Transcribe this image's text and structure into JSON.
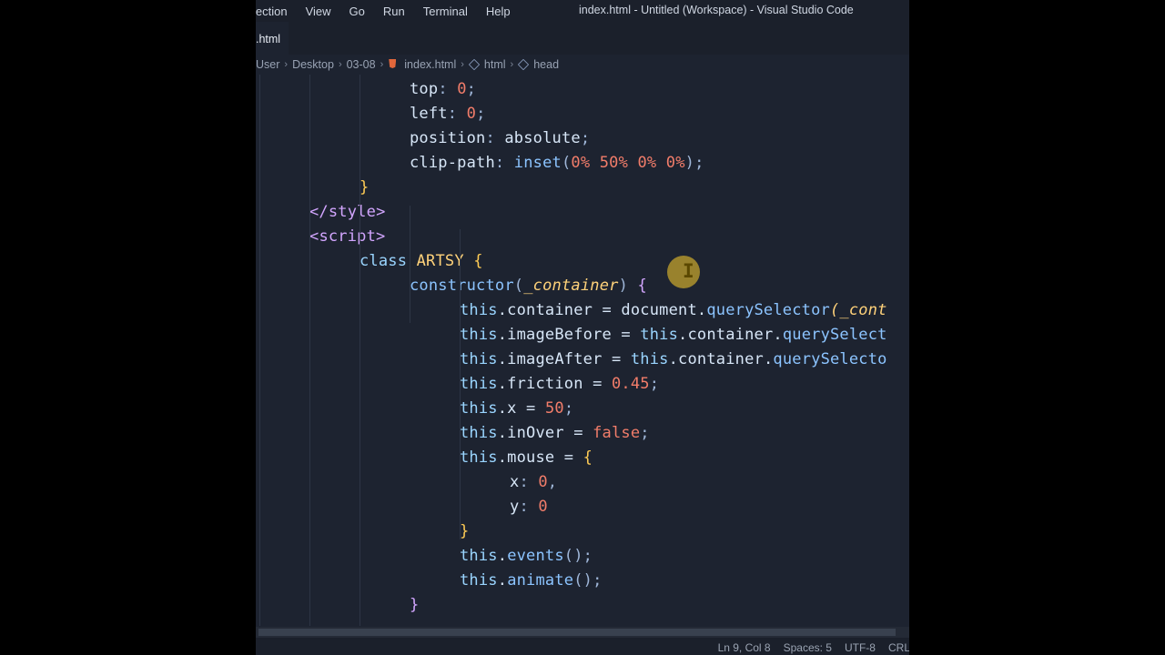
{
  "window": {
    "title": "index.html - Untitled (Workspace) - Visual Studio Code",
    "menu": [
      "lection",
      "View",
      "Go",
      "Run",
      "Terminal",
      "Help"
    ],
    "tab": {
      "label": ".html"
    },
    "breadcrumbs": [
      "User",
      "Desktop",
      "03-08",
      "index.html",
      "html",
      "head"
    ]
  },
  "editor": {
    "lines": [
      [
        {
          "t": "top",
          "c": "tok-prop"
        },
        {
          "t": ": ",
          "c": "tok-punc"
        },
        {
          "t": "0",
          "c": "tok-num"
        },
        {
          "t": ";",
          "c": "tok-punc"
        }
      ],
      [
        {
          "t": "left",
          "c": "tok-prop"
        },
        {
          "t": ": ",
          "c": "tok-punc"
        },
        {
          "t": "0",
          "c": "tok-num"
        },
        {
          "t": ";",
          "c": "tok-punc"
        }
      ],
      [
        {
          "t": "position",
          "c": "tok-prop"
        },
        {
          "t": ": ",
          "c": "tok-punc"
        },
        {
          "t": "absolute",
          "c": "tok-prop"
        },
        {
          "t": ";",
          "c": "tok-punc"
        }
      ],
      [
        {
          "t": "clip-path",
          "c": "tok-prop"
        },
        {
          "t": ": ",
          "c": "tok-punc"
        },
        {
          "t": "inset",
          "c": "tok-fn"
        },
        {
          "t": "(",
          "c": "tok-punc"
        },
        {
          "t": "0%",
          "c": "tok-num"
        },
        {
          "t": " ",
          "c": "tok-punc"
        },
        {
          "t": "50%",
          "c": "tok-num"
        },
        {
          "t": " ",
          "c": "tok-punc"
        },
        {
          "t": "0%",
          "c": "tok-num"
        },
        {
          "t": " ",
          "c": "tok-punc"
        },
        {
          "t": "0%",
          "c": "tok-num"
        },
        {
          "t": ");",
          "c": "tok-punc"
        }
      ],
      [
        {
          "t": "}",
          "c": "tok-brace"
        }
      ],
      [
        {
          "t": "</",
          "c": "tok-tag"
        },
        {
          "t": "style",
          "c": "tok-tag"
        },
        {
          "t": ">",
          "c": "tok-tag"
        }
      ],
      [
        {
          "t": "<",
          "c": "tok-tag"
        },
        {
          "t": "script",
          "c": "tok-tag"
        },
        {
          "t": ">",
          "c": "tok-tag"
        }
      ],
      [
        {
          "t": "class ",
          "c": "tok-kw"
        },
        {
          "t": "ARTSY",
          "c": "tok-class"
        },
        {
          "t": " {",
          "c": "tok-brace"
        }
      ],
      [
        {
          "t": "constructor",
          "c": "tok-fn"
        },
        {
          "t": "(",
          "c": "tok-punc"
        },
        {
          "t": "_container",
          "c": "tok-italic"
        },
        {
          "t": ") ",
          "c": "tok-punc"
        },
        {
          "t": "{",
          "c": "tok-tag"
        }
      ],
      [
        {
          "t": "this",
          "c": "tok-kw"
        },
        {
          "t": ".container = document.",
          "c": "tok-prop"
        },
        {
          "t": "querySelector",
          "c": "tok-fn"
        },
        {
          "t": "(_cont",
          "c": "tok-italic"
        }
      ],
      [
        {
          "t": "this",
          "c": "tok-kw"
        },
        {
          "t": ".imageBefore = ",
          "c": "tok-prop"
        },
        {
          "t": "this",
          "c": "tok-kw"
        },
        {
          "t": ".container.",
          "c": "tok-prop"
        },
        {
          "t": "querySelect",
          "c": "tok-fn"
        }
      ],
      [
        {
          "t": "this",
          "c": "tok-kw"
        },
        {
          "t": ".imageAfter = ",
          "c": "tok-prop"
        },
        {
          "t": "this",
          "c": "tok-kw"
        },
        {
          "t": ".container.",
          "c": "tok-prop"
        },
        {
          "t": "querySelecto",
          "c": "tok-fn"
        }
      ],
      [
        {
          "t": "this",
          "c": "tok-kw"
        },
        {
          "t": ".friction = ",
          "c": "tok-prop"
        },
        {
          "t": "0.45",
          "c": "tok-num"
        },
        {
          "t": ";",
          "c": "tok-punc"
        }
      ],
      [
        {
          "t": "this",
          "c": "tok-kw"
        },
        {
          "t": ".x = ",
          "c": "tok-prop"
        },
        {
          "t": "50",
          "c": "tok-num"
        },
        {
          "t": ";",
          "c": "tok-punc"
        }
      ],
      [
        {
          "t": "this",
          "c": "tok-kw"
        },
        {
          "t": ".inOver = ",
          "c": "tok-prop"
        },
        {
          "t": "false",
          "c": "tok-bool"
        },
        {
          "t": ";",
          "c": "tok-punc"
        }
      ],
      [
        {
          "t": "this",
          "c": "tok-kw"
        },
        {
          "t": ".mouse = ",
          "c": "tok-prop"
        },
        {
          "t": "{",
          "c": "tok-brace"
        }
      ],
      [
        {
          "t": "x",
          "c": "tok-prop"
        },
        {
          "t": ": ",
          "c": "tok-punc"
        },
        {
          "t": "0",
          "c": "tok-num"
        },
        {
          "t": ",",
          "c": "tok-punc"
        }
      ],
      [
        {
          "t": "y",
          "c": "tok-prop"
        },
        {
          "t": ": ",
          "c": "tok-punc"
        },
        {
          "t": "0",
          "c": "tok-num"
        }
      ],
      [
        {
          "t": "}",
          "c": "tok-brace"
        }
      ],
      [
        {
          "t": "this",
          "c": "tok-kw"
        },
        {
          "t": ".",
          "c": "tok-prop"
        },
        {
          "t": "events",
          "c": "tok-fn"
        },
        {
          "t": "();",
          "c": "tok-punc"
        }
      ],
      [
        {
          "t": "this",
          "c": "tok-kw"
        },
        {
          "t": ".",
          "c": "tok-prop"
        },
        {
          "t": "animate",
          "c": "tok-fn"
        },
        {
          "t": "();",
          "c": "tok-punc"
        }
      ],
      [
        {
          "t": "}",
          "c": "tok-tag"
        }
      ]
    ],
    "cursor": {
      "type": "text"
    }
  },
  "status": {
    "position": "Ln 9, Col 8",
    "spaces": "Spaces: 5",
    "encoding": "UTF-8",
    "eol": "CRL"
  },
  "colors": {
    "background": "#1d2330",
    "chrome": "#1b202b",
    "cursor": "#c9a82c"
  }
}
